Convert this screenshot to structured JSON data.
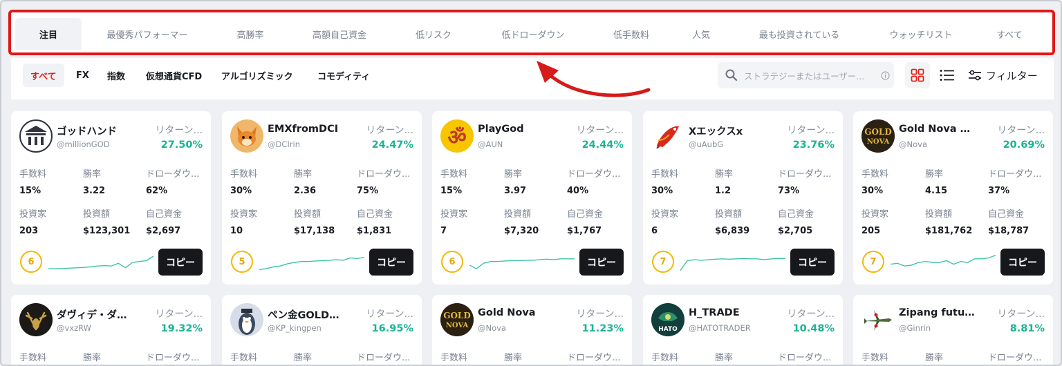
{
  "tabs": [
    "注目",
    "最優秀パフォーマー",
    "高勝率",
    "高額自己資金",
    "低リスク",
    "低ドローダウン",
    "低手数料",
    "人気",
    "最も投資されている",
    "ウォッチリスト",
    "すべて"
  ],
  "categories": [
    "すべて",
    "FX",
    "指数",
    "仮想通貨CFD",
    "アルゴリズミック",
    "コモディティ"
  ],
  "search": {
    "placeholder": "ストラテジーまたはユーザー..."
  },
  "filter_label": "フィルター",
  "labels": {
    "return": "リターン...",
    "fee": "手数料",
    "winrate": "勝率",
    "drawdown": "ドローダウ...",
    "investors": "投資家",
    "invested": "投資額",
    "own_funds": "自己資金",
    "copy": "コピー"
  },
  "accent": "#e0241a",
  "positive_color": "#1bb394",
  "cards": [
    {
      "name": "ゴッドハンド",
      "handle": "@millionGOD",
      "return": "27.50%",
      "fee": "15%",
      "winrate": "3.22",
      "drawdown": "62%",
      "investors": "203",
      "invested": "$123,301",
      "own_funds": "$2,697",
      "rank": "6",
      "avatar_icon": "pillar-logo-icon"
    },
    {
      "name": "EMXfromDCI",
      "handle": "@DCIrin",
      "return": "24.47%",
      "fee": "30%",
      "winrate": "2.36",
      "drawdown": "75%",
      "investors": "10",
      "invested": "$17,138",
      "own_funds": "$1,831",
      "rank": "5",
      "avatar_icon": "fox-avatar-icon"
    },
    {
      "name": "PlayGod",
      "handle": "@AUN",
      "return": "24.44%",
      "fee": "15%",
      "winrate": "3.97",
      "drawdown": "40%",
      "investors": "7",
      "invested": "$7,320",
      "own_funds": "$1,767",
      "rank": "6",
      "avatar_icon": "om-symbol-icon"
    },
    {
      "name": "Xエックスx",
      "handle": "@uAubG",
      "return": "23.76%",
      "fee": "30%",
      "winrate": "1.2",
      "drawdown": "73%",
      "investors": "6",
      "invested": "$6,839",
      "own_funds": "$2,705",
      "rank": "7",
      "avatar_icon": "koi-fish-icon"
    },
    {
      "name": "Gold Nova Ultim...",
      "handle": "@Nova",
      "return": "20.69%",
      "fee": "30%",
      "winrate": "4.15",
      "drawdown": "37%",
      "investors": "205",
      "invested": "$181,762",
      "own_funds": "$18,787",
      "rank": "7",
      "avatar_icon": "gold-nova-logo-icon"
    },
    {
      "name": "ダヴィデ・ダヴ...",
      "handle": "@vxzRW",
      "return": "19.32%",
      "avatar_icon": "stag-logo-icon"
    },
    {
      "name": "ペン金GOLDラ...",
      "handle": "@KP_kingpen",
      "return": "16.95%",
      "avatar_icon": "penguin-avatar-icon"
    },
    {
      "name": "Gold Nova",
      "handle": "@Nova",
      "return": "11.23%",
      "avatar_icon": "gold-nova-logo-icon"
    },
    {
      "name": "H_TRADE",
      "handle": "@HATOTRADER",
      "return": "10.48%",
      "avatar_icon": "hato-logo-icon"
    },
    {
      "name": "Zipang future",
      "handle": "@Ginrin",
      "return": "8.81%",
      "avatar_icon": "fighter-plane-icon"
    }
  ],
  "sparklines": [
    [
      0.15,
      0.15,
      0.16,
      0.18,
      0.2,
      0.22,
      0.25,
      0.3,
      0.32,
      0.3,
      0.45,
      0.2,
      0.5,
      0.55,
      0.6,
      0.85
    ],
    [
      0.1,
      0.15,
      0.25,
      0.3,
      0.42,
      0.5,
      0.55,
      0.55,
      0.58,
      0.6,
      0.62,
      0.65,
      0.62,
      0.75,
      0.72,
      0.78
    ],
    [
      0.35,
      0.15,
      0.45,
      0.55,
      0.55,
      0.58,
      0.6,
      0.6,
      0.62,
      0.62,
      0.65,
      0.68,
      0.65,
      0.7,
      0.7,
      0.7
    ],
    [
      0.05,
      0.6,
      0.65,
      0.62,
      0.65,
      0.68,
      0.7,
      0.68,
      0.7,
      0.72,
      0.7,
      0.7,
      0.65,
      0.7,
      0.72,
      0.72
    ],
    [
      0.4,
      0.45,
      0.3,
      0.35,
      0.5,
      0.55,
      0.5,
      0.5,
      0.6,
      0.4,
      0.55,
      0.5,
      0.7,
      0.7,
      0.75,
      0.9
    ]
  ]
}
